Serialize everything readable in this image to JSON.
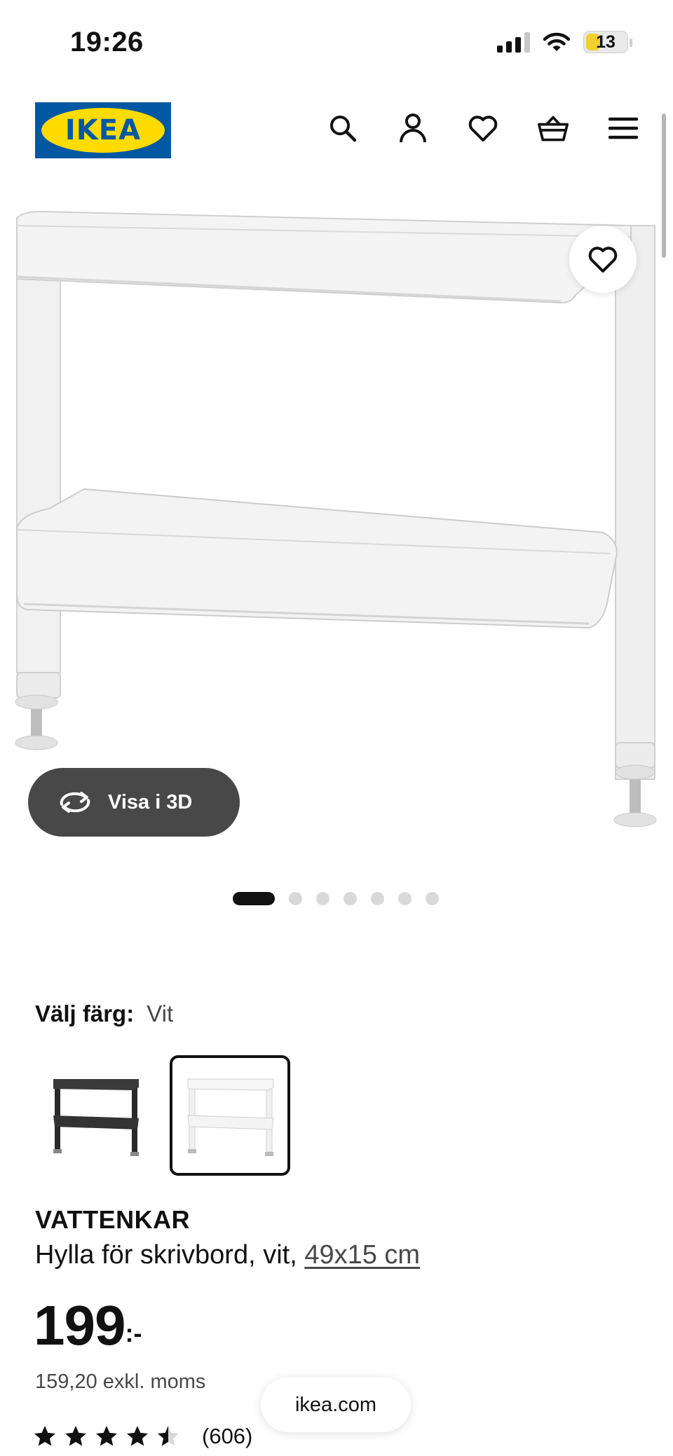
{
  "status_bar": {
    "time": "19:26",
    "battery": "13",
    "icons": [
      "signal-icon",
      "wifi-icon",
      "battery-icon"
    ]
  },
  "header": {
    "logo_text": "IKEA",
    "icons": [
      "search-icon",
      "account-icon",
      "heart-icon",
      "cart-icon",
      "menu-icon"
    ]
  },
  "gallery": {
    "view_3d_label": "Visa i 3D",
    "total_images": 7,
    "active_image": 1,
    "favorite_icon": "heart-icon"
  },
  "color_picker": {
    "label": "Välj färg:",
    "selected": "Vit",
    "options": [
      "black",
      "white"
    ]
  },
  "product": {
    "name": "VATTENKAR",
    "description": "Hylla för skrivbord, vit,",
    "size": "49x15 cm",
    "price": "199",
    "price_suffix": ":-",
    "price_ex_vat": "159,20 exkl. moms",
    "rating": 4.5,
    "review_count": "(606)"
  },
  "browser": {
    "site": "ikea.com"
  },
  "colors": {
    "brand_blue": "#0058a3",
    "brand_yellow": "#ffdb00",
    "dark_button": "#484848"
  }
}
